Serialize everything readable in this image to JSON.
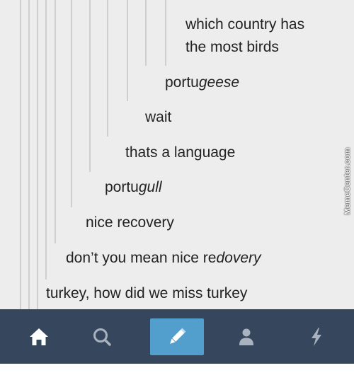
{
  "thread": {
    "messages": [
      {
        "parts": [
          {
            "text": "which country has",
            "italic": false
          }
        ]
      },
      {
        "parts": [
          {
            "text": "the most birds",
            "italic": false
          }
        ]
      },
      {
        "parts": [
          {
            "text": "portu",
            "italic": false
          },
          {
            "text": "geese",
            "italic": true
          }
        ]
      },
      {
        "parts": [
          {
            "text": "wait",
            "italic": false
          }
        ]
      },
      {
        "parts": [
          {
            "text": "thats a language",
            "italic": false
          }
        ]
      },
      {
        "parts": [
          {
            "text": "portu",
            "italic": false
          },
          {
            "text": "gull",
            "italic": true
          }
        ]
      },
      {
        "parts": [
          {
            "text": "nice recovery",
            "italic": false
          }
        ]
      },
      {
        "parts": [
          {
            "text": "don’t you mean nice re",
            "italic": false
          },
          {
            "text": "dovery",
            "italic": true
          }
        ]
      },
      {
        "parts": [
          {
            "text": "turkey, how did we miss turkey",
            "italic": false
          }
        ]
      }
    ]
  },
  "watermark": {
    "text": "MemeCenter.com"
  },
  "tabbar": {
    "tabs": [
      {
        "name": "home",
        "icon": "home-icon"
      },
      {
        "name": "search",
        "icon": "search-icon"
      },
      {
        "name": "compose",
        "icon": "pencil-icon",
        "active": true
      },
      {
        "name": "account",
        "icon": "person-icon"
      },
      {
        "name": "activity",
        "icon": "lightning-icon"
      }
    ]
  },
  "colors": {
    "tabbar_bg": "#36465d",
    "compose_bg": "#529ecc",
    "icon_active": "#ffffff",
    "icon_inactive": "#a9b2bf",
    "text": "#222222",
    "thread_line": "#cfcfcf",
    "photo_bg": "#ededed"
  }
}
